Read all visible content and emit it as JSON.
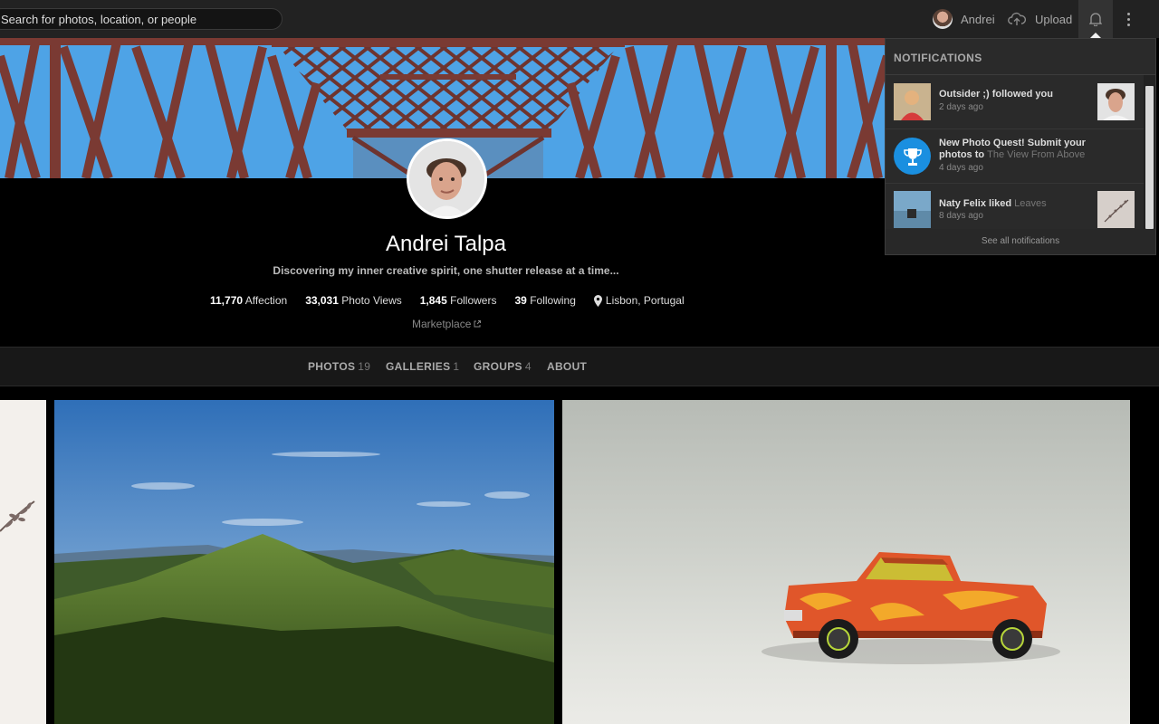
{
  "header": {
    "search_placeholder": "Search for photos, location, or people",
    "user_name": "Andrei",
    "upload_label": "Upload"
  },
  "profile": {
    "name": "Andrei Talpa",
    "bio": "Discovering my inner creative spirit, one shutter release at a time...",
    "stats": [
      {
        "value": "11,770",
        "label": "Affection"
      },
      {
        "value": "33,031",
        "label": "Photo Views"
      },
      {
        "value": "1,845",
        "label": "Followers"
      },
      {
        "value": "39",
        "label": "Following"
      }
    ],
    "location": "Lisbon, Portugal",
    "marketplace": "Marketplace"
  },
  "tabs": [
    {
      "label": "PHOTOS",
      "count": "19"
    },
    {
      "label": "GALLERIES",
      "count": "1"
    },
    {
      "label": "GROUPS",
      "count": "4"
    },
    {
      "label": "ABOUT",
      "count": ""
    }
  ],
  "notifications": {
    "title": "NOTIFICATIONS",
    "items": [
      {
        "actor": "Outsider ;)",
        "action": "followed you",
        "target": "",
        "time": "2 days ago"
      },
      {
        "actor": "New Photo Quest! Submit your photos to",
        "action": "",
        "target": "The View From Above",
        "time": "4 days ago"
      },
      {
        "actor": "Naty Felix",
        "action": "liked",
        "target": "Leaves",
        "time": "8 days ago"
      }
    ],
    "see_all": "See all notifications"
  },
  "colors": {
    "topbar": "#222222",
    "quest_blue": "#1a8fe0",
    "bridge_red": "#7a3a33"
  },
  "icons": [
    "upload-cloud-icon",
    "bell-icon",
    "more-vertical-icon",
    "location-pin-icon",
    "external-link-icon",
    "trophy-icon"
  ]
}
